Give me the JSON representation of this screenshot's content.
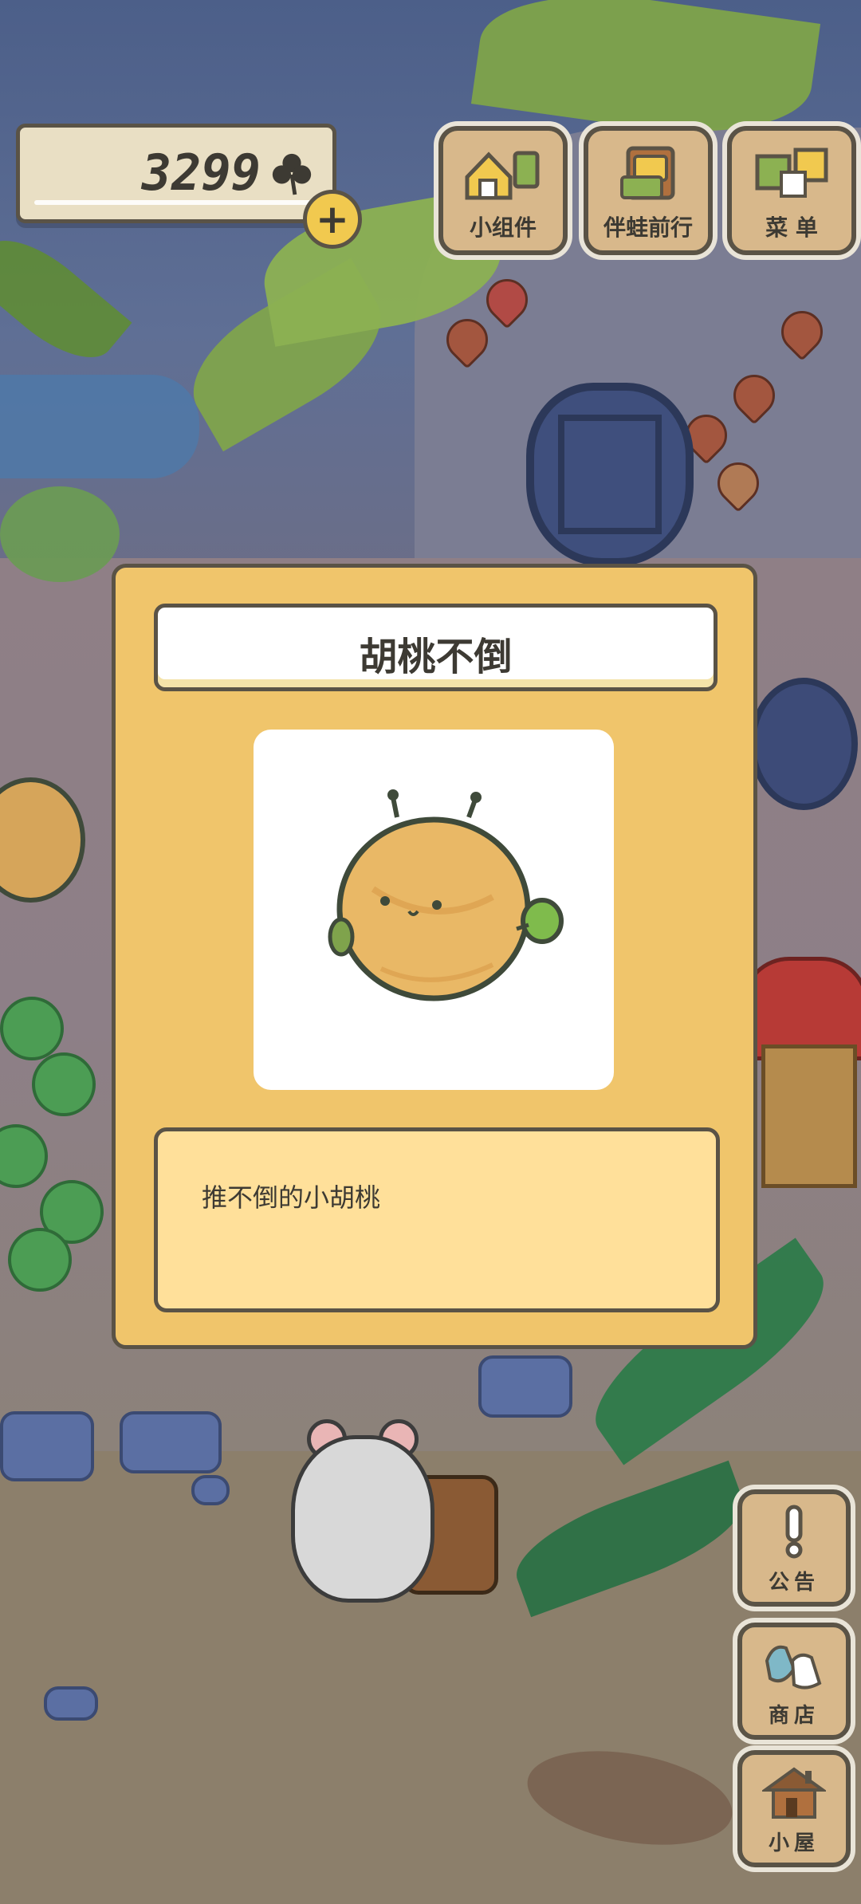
{
  "currency": {
    "amount": "3299",
    "icon": "clover-icon",
    "add_button": "+"
  },
  "top_buttons": [
    {
      "label": "小组件",
      "icon": "widget-icon"
    },
    {
      "label": "伴蛙前行",
      "icon": "frog-journey-icon"
    },
    {
      "label": "菜 单",
      "icon": "menu-icon"
    }
  ],
  "item_dialog": {
    "title": "胡桃不倒",
    "description": "推不倒的小胡桃",
    "image": "walnut-tumbler-icon"
  },
  "side_buttons": [
    {
      "label": "公告",
      "icon": "exclamation-icon"
    },
    {
      "label": "商店",
      "icon": "shop-bags-icon"
    },
    {
      "label": "小屋",
      "icon": "house-icon"
    }
  ],
  "colors": {
    "dialog_bg": "#f0c56b",
    "description_bg": "#ffe09a",
    "border": "#5a5346",
    "button_bg": "#d8b88b",
    "coin_button": "#f1c94f"
  }
}
